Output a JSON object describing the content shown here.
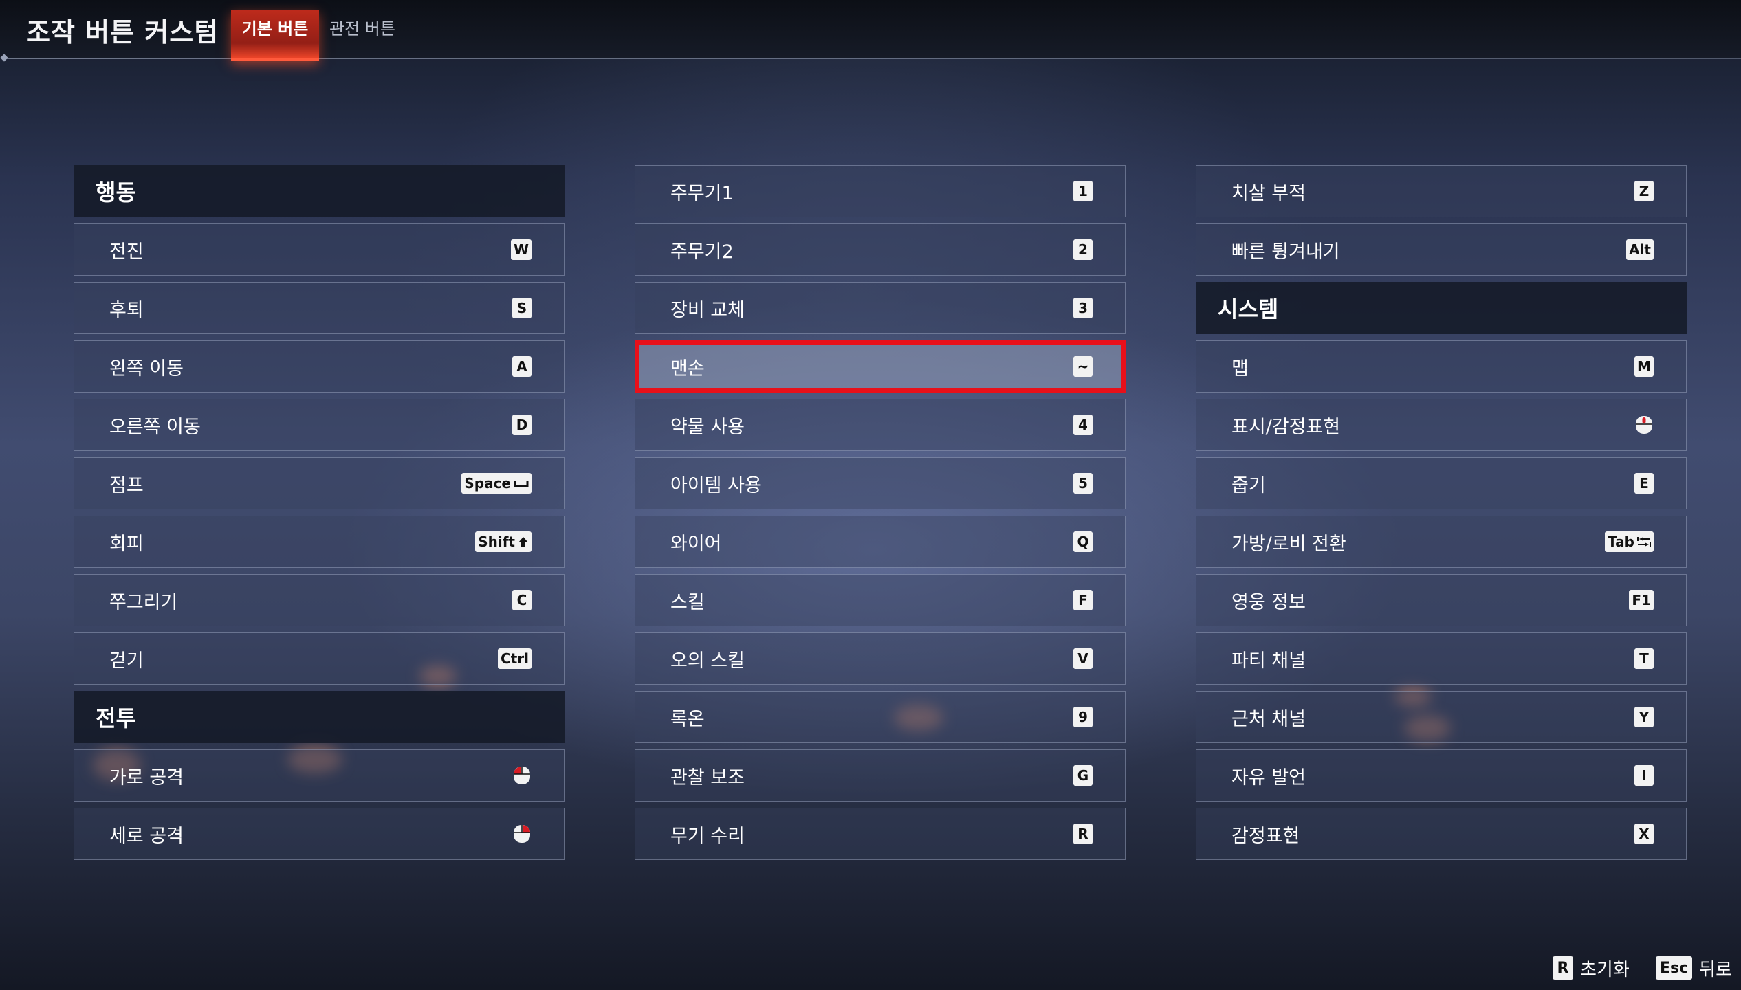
{
  "header": {
    "title": "조작 버튼 커스텀",
    "tabs": [
      {
        "label": "기본 버튼",
        "active": true
      },
      {
        "label": "관전 버튼",
        "active": false
      }
    ]
  },
  "columns": {
    "col1": {
      "sections": [
        {
          "title": "행동",
          "rows": [
            {
              "label": "전진",
              "key": "W"
            },
            {
              "label": "후퇴",
              "key": "S"
            },
            {
              "label": "왼쪽 이동",
              "key": "A"
            },
            {
              "label": "오른쪽 이동",
              "key": "D"
            },
            {
              "label": "점프",
              "key": "Space",
              "key_icon": "space-icon"
            },
            {
              "label": "회피",
              "key": "Shift",
              "key_icon": "shift-arrow-icon"
            },
            {
              "label": "쭈그리기",
              "key": "C"
            },
            {
              "label": "걷기",
              "key": "Ctrl"
            }
          ]
        },
        {
          "title": "전투",
          "rows": [
            {
              "label": "가로 공격",
              "key_icon": "mouse-left-click-icon"
            },
            {
              "label": "세로 공격",
              "key_icon": "mouse-right-click-icon"
            }
          ]
        }
      ]
    },
    "col2": {
      "rows": [
        {
          "label": "주무기1",
          "key": "1"
        },
        {
          "label": "주무기2",
          "key": "2"
        },
        {
          "label": "장비 교체",
          "key": "3"
        },
        {
          "label": "맨손",
          "key": "~",
          "selected": true
        },
        {
          "label": "약물 사용",
          "key": "4"
        },
        {
          "label": "아이템 사용",
          "key": "5"
        },
        {
          "label": "와이어",
          "key": "Q"
        },
        {
          "label": "스킬",
          "key": "F"
        },
        {
          "label": "오의 스킬",
          "key": "V"
        },
        {
          "label": "록온",
          "key": "9"
        },
        {
          "label": "관찰 보조",
          "key": "G"
        },
        {
          "label": "무기 수리",
          "key": "R"
        }
      ]
    },
    "col3": {
      "rows_top": [
        {
          "label": "치살 부적",
          "key": "Z"
        },
        {
          "label": "빠른 튕겨내기",
          "key": "Alt"
        }
      ],
      "section_title": "시스템",
      "rows_system": [
        {
          "label": "맵",
          "key": "M"
        },
        {
          "label": "표시/감정표현",
          "key_icon": "mouse-middle-click-icon"
        },
        {
          "label": "줍기",
          "key": "E"
        },
        {
          "label": "가방/로비 전환",
          "key": "Tab",
          "key_icon": "tab-arrows-icon"
        },
        {
          "label": "영웅 정보",
          "key": "F1"
        },
        {
          "label": "파티 채널",
          "key": "T"
        },
        {
          "label": "근처 채널",
          "key": "Y"
        },
        {
          "label": "자유 발언",
          "key": "I"
        },
        {
          "label": "감정표현",
          "key": "X"
        }
      ]
    }
  },
  "footer": {
    "reset": {
      "key": "R",
      "label": "초기화"
    },
    "back": {
      "key": "Esc",
      "label": "뒤로"
    }
  },
  "colors": {
    "accent_red": "#e8101a",
    "tab_active": "#cd2d1c",
    "keycap": "#f2f2f2",
    "mouse_click": "#d81b24"
  }
}
